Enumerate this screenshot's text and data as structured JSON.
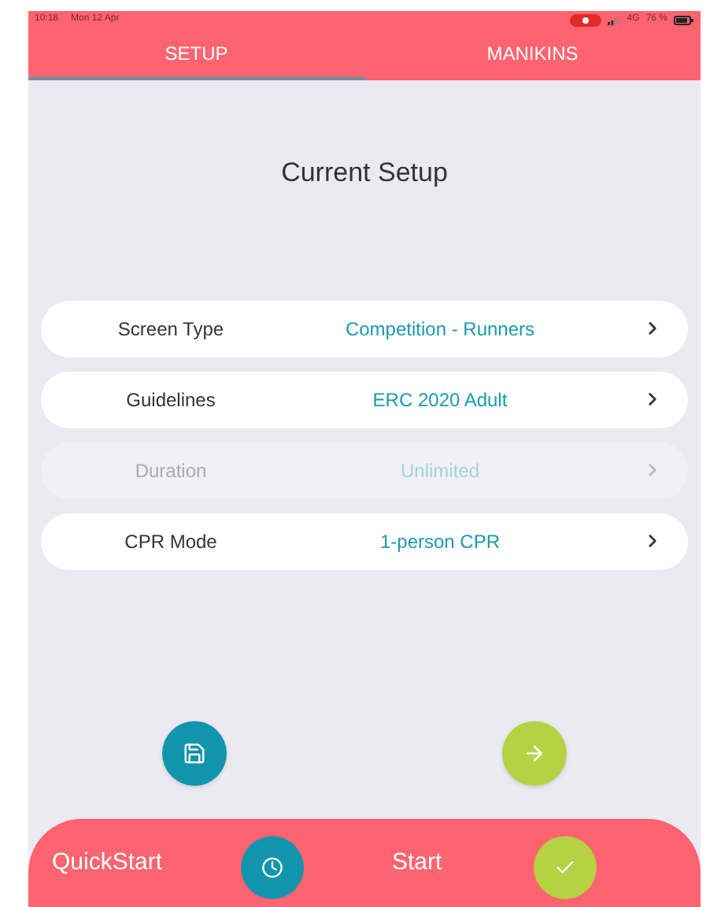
{
  "status_bar": {
    "time": "10:18",
    "date": "Mon 12 Apr",
    "network": "4G",
    "battery": "76 %"
  },
  "tabs": [
    {
      "label": "SETUP",
      "selected": true
    },
    {
      "label": "MANIKINS",
      "selected": false
    }
  ],
  "title": "Current Setup",
  "settings": [
    {
      "label": "Screen Type",
      "value": "Competition - Runners",
      "disabled": false
    },
    {
      "label": "Guidelines",
      "value": "ERC 2020 Adult",
      "disabled": false
    },
    {
      "label": "Duration",
      "value": "Unlimited",
      "disabled": true
    },
    {
      "label": "CPR Mode",
      "value": "1-person CPR",
      "disabled": false
    }
  ],
  "bottom_bar": {
    "quickstart": "QuickStart",
    "start": "Start"
  }
}
